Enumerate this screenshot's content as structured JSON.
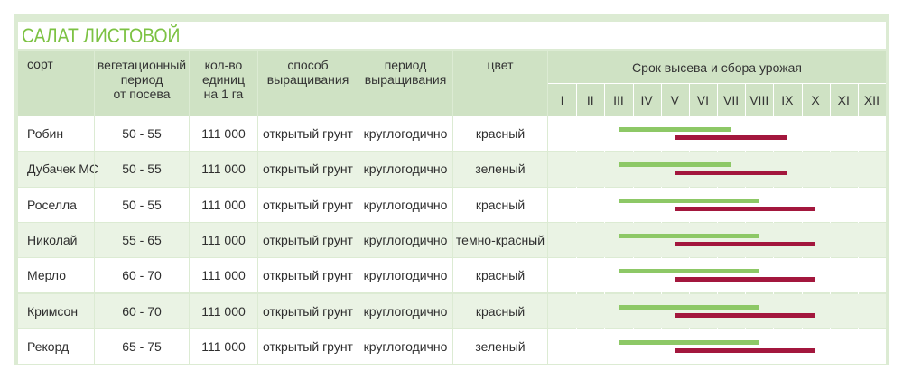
{
  "title": "САЛАТ ЛИСТОВОЙ",
  "headers": {
    "sort": "сорт",
    "veg": [
      "вегетационный",
      "период",
      "от посева"
    ],
    "count": [
      "кол-во",
      "единиц",
      "на 1 га"
    ],
    "method": [
      "способ",
      "выращивания"
    ],
    "period": [
      "период",
      "выращивания"
    ],
    "color": "цвет",
    "schedule": "Срок высева и сбора урожая"
  },
  "months": [
    "I",
    "II",
    "III",
    "IV",
    "V",
    "VI",
    "VII",
    "VIII",
    "IX",
    "X",
    "XI",
    "XII"
  ],
  "colors": {
    "sowing": "#8dc866",
    "harvest": "#a3173d",
    "title": "#7cc243",
    "header_bg": "#cfe2c4"
  },
  "rows": [
    {
      "sort": "Робин",
      "veg": "50 - 55",
      "count": "111 000",
      "method": "открытый грунт",
      "period": "круглогодично",
      "color": "красный",
      "sow_months": [
        3,
        7
      ],
      "harvest_months": [
        5,
        9
      ]
    },
    {
      "sort": "Дубачек МС",
      "veg": "50 - 55",
      "count": "111 000",
      "method": "открытый грунт",
      "period": "круглогодично",
      "color": "зеленый",
      "sow_months": [
        3,
        7
      ],
      "harvest_months": [
        5,
        9
      ]
    },
    {
      "sort": "Роселла",
      "veg": "50 - 55",
      "count": "111 000",
      "method": "открытый грунт",
      "period": "круглогодично",
      "color": "красный",
      "sow_months": [
        3,
        8
      ],
      "harvest_months": [
        5,
        10
      ]
    },
    {
      "sort": "Николай",
      "veg": "55 - 65",
      "count": "111 000",
      "method": "открытый грунт",
      "period": "круглогодично",
      "color": "темно-красный",
      "sow_months": [
        3,
        8
      ],
      "harvest_months": [
        5,
        10
      ]
    },
    {
      "sort": "Мерло",
      "veg": "60 - 70",
      "count": "111 000",
      "method": "открытый грунт",
      "period": "круглогодично",
      "color": "красный",
      "sow_months": [
        3,
        8
      ],
      "harvest_months": [
        5,
        10
      ]
    },
    {
      "sort": "Кримсон",
      "veg": "60 - 70",
      "count": "111 000",
      "method": "открытый грунт",
      "period": "круглогодично",
      "color": "красный",
      "sow_months": [
        3,
        8
      ],
      "harvest_months": [
        5,
        10
      ]
    },
    {
      "sort": "Рекорд",
      "veg": "65 - 75",
      "count": "111 000",
      "method": "открытый грунт",
      "period": "круглогодично",
      "color": "зеленый",
      "sow_months": [
        3,
        8
      ],
      "harvest_months": [
        5,
        10
      ]
    }
  ]
}
